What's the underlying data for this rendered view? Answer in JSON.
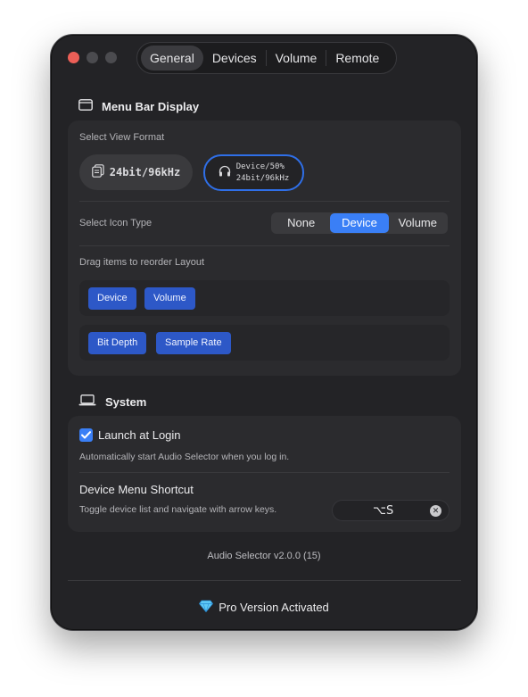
{
  "tabs": [
    {
      "label": "General",
      "active": true
    },
    {
      "label": "Devices",
      "active": false
    },
    {
      "label": "Volume",
      "active": false
    },
    {
      "label": "Remote",
      "active": false
    }
  ],
  "menu_bar": {
    "title": "Menu Bar Display",
    "view_format_label": "Select View Format",
    "format_option_a": "24bit/96kHz",
    "format_option_b_line1": "Device/50%",
    "format_option_b_line2": "24bit/96kHz",
    "icon_type_label": "Select Icon Type",
    "icon_types": [
      "None",
      "Device",
      "Volume"
    ],
    "icon_type_selected": "Device",
    "reorder_label": "Drag items to reorder Layout",
    "row1_items": [
      "Device",
      "Volume"
    ],
    "row2_items": [
      "Bit Depth",
      "Sample Rate"
    ]
  },
  "system": {
    "title": "System",
    "launch_label": "Launch at Login",
    "launch_checked": true,
    "launch_desc": "Automatically start Audio Selector when you log in.",
    "shortcut_title": "Device Menu Shortcut",
    "shortcut_desc": "Toggle device list and navigate with arrow keys.",
    "shortcut_keys": "⌥S"
  },
  "footer": {
    "version": "Audio Selector v2.0.0 (15)",
    "pro_status": "Pro Version Activated"
  },
  "colors": {
    "accent": "#3a7ff6",
    "chip": "#2d58c7",
    "window_bg": "#232326",
    "card_bg": "#2b2b2e"
  },
  "icons": {
    "menu_bar": "window-icon",
    "system": "laptop-icon",
    "format_a": "document-stack-icon",
    "format_b": "headphones-icon",
    "pro": "gem-icon"
  }
}
